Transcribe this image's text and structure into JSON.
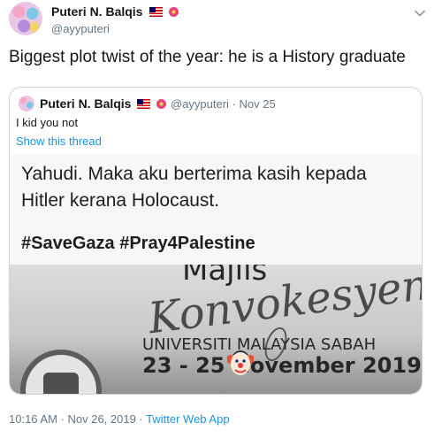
{
  "author": {
    "display_name": "Puteri N. Balqis",
    "handle": "@ayyputeri"
  },
  "tweet": {
    "text": "Biggest plot twist of the year: he is a History graduate"
  },
  "quoted_tweet": {
    "display_name": "Puteri N. Balqis",
    "handle_date": "@ayyputeri · Nov 25",
    "text": "I kid you not",
    "show_thread": "Show this thread",
    "image": {
      "line1": "Yahudi. Maka aku berterima kasih kepada",
      "line2": "Hitler kerana Holocaust.",
      "hashtags": "#SaveGaza #Pray4Palestine",
      "sign_majlis": "Majlis",
      "sign_konvokesyen": "Konvokesyen",
      "sign_university": "UNIVERSITI MALAYSIA SABAH",
      "sign_date": "23 - 25 November 2019"
    }
  },
  "meta": {
    "timestamp": "10:16 AM · Nov 26, 2019 · ",
    "app": "Twitter Web App"
  },
  "icons": {
    "caret": "chevron-down-icon",
    "flag": "malaysia-flag-emoji",
    "flower": "hibiscus-emoji",
    "clown": "clown-face-emoji"
  },
  "colors": {
    "link": "#1b95e0",
    "secondary_text": "#657786",
    "border": "#ccd6dd"
  }
}
